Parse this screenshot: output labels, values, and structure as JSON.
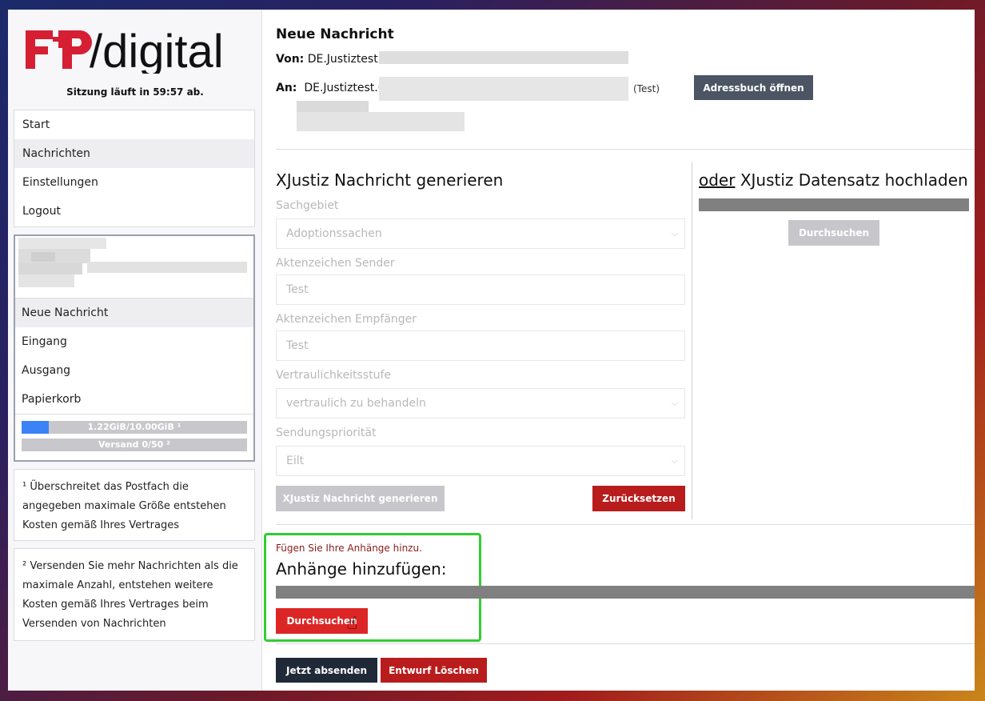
{
  "logo": {
    "brand": "FP",
    "suffix": "/digital"
  },
  "session": {
    "text": "Sitzung läuft in 59:57 ab."
  },
  "nav": {
    "items": [
      "Start",
      "Nachrichten",
      "Einstellungen",
      "Logout"
    ],
    "active_index": 1
  },
  "mailbox": {
    "items": [
      "Neue Nachricht",
      "Eingang",
      "Ausgang",
      "Papierkorb"
    ],
    "active_index": 0,
    "storage": {
      "text": "1.22GiB/10.00GiB ¹",
      "fraction": 0.122
    },
    "send": {
      "text": "Versand 0/50 ²",
      "fraction": 0.0
    }
  },
  "notes": {
    "note1": "¹ Überschreitet das Postfach die angegeben maximale Größe entstehen Kosten gemäß Ihres Vertrages",
    "note2": "² Versenden Sie mehr Nachrichten als die maximale Anzahl, entstehen weitere Kosten gemäß Ihres Vertrages beim Versenden von Nachrichten"
  },
  "message": {
    "title": "Neue Nachricht",
    "from_label": "Von:",
    "from_value": "DE.Justiztest.1",
    "to_label": "An:",
    "to_value": "DE.Justiztest.6",
    "to_tag": "(Test)",
    "addressbook_button": "Adressbuch öffnen"
  },
  "xjustiz": {
    "title": "XJustiz Nachricht generieren",
    "fields": {
      "sachgebiet": {
        "label": "Sachgebiet",
        "value": "Adoptionssachen"
      },
      "az_sender": {
        "label": "Aktenzeichen Sender",
        "value": "Test"
      },
      "az_empfaenger": {
        "label": "Aktenzeichen Empfänger",
        "value": "Test"
      },
      "vertraulichkeit": {
        "label": "Vertraulichkeitsstufe",
        "value": "vertraulich zu behandeln"
      },
      "prioritaet": {
        "label": "Sendungspriorität",
        "value": "Eilt"
      }
    },
    "generate_button": "XJustiz Nachricht generieren",
    "reset_button": "Zurücksetzen"
  },
  "upload": {
    "or_word": "oder",
    "title_rest": " XJustiz Datensatz hochladen",
    "browse_button": "Durchsuchen"
  },
  "attachments": {
    "hint": "Fügen Sie Ihre Anhänge hinzu.",
    "title": "Anhänge hinzufügen:",
    "browse_button": "Durchsuchen"
  },
  "footer": {
    "send_button": "Jetzt absenden",
    "delete_button": "Entwurf Löschen"
  },
  "colors": {
    "brand_red": "#d61f32",
    "accent_red": "#b91c1c",
    "highlight_green": "#33cc33",
    "progress_blue": "#3b82f6"
  },
  "icons": [
    "chevron-down-icon",
    "hand-cursor-icon"
  ]
}
